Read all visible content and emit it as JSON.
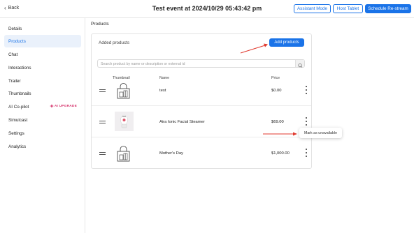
{
  "header": {
    "back_label": "Back",
    "title": "Test event at 2024/10/29 05:43:42 pm",
    "buttons": {
      "assistant_mode": "Assistant Mode",
      "host_tablet": "Host Tablet",
      "schedule_restream": "Schedule Re-stream"
    }
  },
  "sidebar": {
    "items": [
      {
        "label": "Details"
      },
      {
        "label": "Products"
      },
      {
        "label": "Chat"
      },
      {
        "label": "Interactions"
      },
      {
        "label": "Trailer"
      },
      {
        "label": "Thumbnails"
      },
      {
        "label": "AI Co-pilot",
        "badge": "AI UPGRADE"
      },
      {
        "label": "Simulcast"
      },
      {
        "label": "Settings"
      },
      {
        "label": "Analytics"
      }
    ],
    "active_index": 1
  },
  "main": {
    "section_title": "Products",
    "panel_title": "Added products",
    "add_button": "Add products",
    "search_placeholder": "Search product by name or description or external id",
    "columns": {
      "thumbnail": "Thumbnail",
      "name": "Name",
      "price": "Price"
    },
    "products": [
      {
        "name": "test",
        "price": "$0.00",
        "thumbnail_icon": "shopping-bag-icon"
      },
      {
        "name": "Aira Ionic Facial Steamer",
        "price": "$69.00",
        "thumbnail_icon": "product-photo"
      },
      {
        "name": "Mother's Day",
        "price": "$1,000.00",
        "thumbnail_icon": "shopping-bag-icon"
      }
    ],
    "context_menu": {
      "item": "Mark as unavailable"
    }
  },
  "colors": {
    "accent": "#1a73e8",
    "annotation_arrow": "#e03a2f",
    "ai_badge": "#d6336c",
    "active_nav_bg": "#eaf1fb"
  }
}
